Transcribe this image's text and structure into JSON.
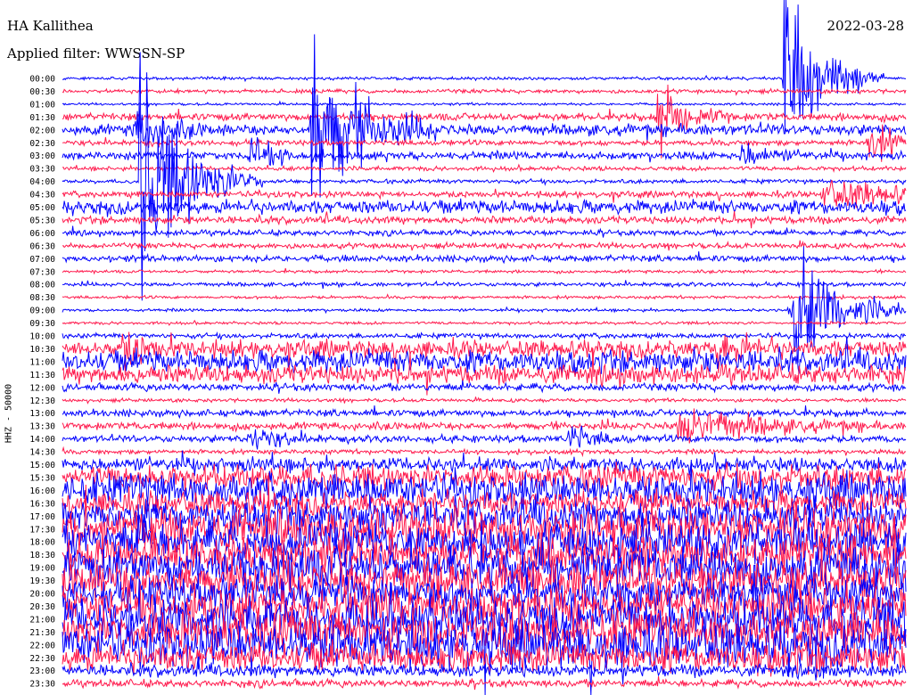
{
  "header": {
    "station": "HA Kallithea",
    "filter_label": "Applied filter:",
    "filter_name": "WWSSN-SP",
    "date": "2022-03-28"
  },
  "colors": {
    "odd": "#0000ff",
    "even": "#ff1a4d",
    "text": "#000000"
  },
  "chart_data": {
    "type": "line",
    "title": "HA Kallithea",
    "ylabel": "HHZ - 50000",
    "xlabel": "",
    "grid": false,
    "series_colors": [
      "#0000ff",
      "#ff1a4d"
    ],
    "row_labels": [
      "00:00",
      "00:30",
      "01:00",
      "01:30",
      "02:00",
      "02:30",
      "03:00",
      "03:30",
      "04:00",
      "04:30",
      "05:00",
      "05:30",
      "06:00",
      "06:30",
      "07:00",
      "07:30",
      "08:00",
      "08:30",
      "09:00",
      "09:30",
      "10:00",
      "10:30",
      "11:00",
      "11:30",
      "12:00",
      "12:30",
      "13:00",
      "13:30",
      "14:00",
      "14:30",
      "15:00",
      "15:30",
      "16:00",
      "16:30",
      "17:00",
      "17:30",
      "18:00",
      "18:30",
      "19:00",
      "19:30",
      "20:00",
      "20:30",
      "21:00",
      "21:30",
      "22:00",
      "22:30",
      "23:00",
      "23:30"
    ],
    "row_noise": [
      1.2,
      1.6,
      1.0,
      3.0,
      4.5,
      2.2,
      3.2,
      1.8,
      1.6,
      2.5,
      5.5,
      3.0,
      2.2,
      2.2,
      2.6,
      1.2,
      1.6,
      1.2,
      1.2,
      1.2,
      2.0,
      7.0,
      9.0,
      7.5,
      3.0,
      1.4,
      2.8,
      3.0,
      2.8,
      1.8,
      6.0,
      10.0,
      14.0,
      10.0,
      13.0,
      16.0,
      16.0,
      15.0,
      17.0,
      16.0,
      14.0,
      16.0,
      18.0,
      17.0,
      18.0,
      12.0,
      5.0,
      3.0
    ],
    "events": [
      {
        "row": 0,
        "x": 0.855,
        "amplitude": 85,
        "duration": 0.04
      },
      {
        "row": 3,
        "x": 0.705,
        "amplitude": 40,
        "duration": 0.03
      },
      {
        "row": 4,
        "x": 0.295,
        "amplitude": 90,
        "duration": 0.05
      },
      {
        "row": 4,
        "x": 0.085,
        "amplitude": 25,
        "duration": 0.03
      },
      {
        "row": 5,
        "x": 0.955,
        "amplitude": 18,
        "duration": 0.05
      },
      {
        "row": 6,
        "x": 0.22,
        "amplitude": 18,
        "duration": 0.03
      },
      {
        "row": 6,
        "x": 0.805,
        "amplitude": 14,
        "duration": 0.03
      },
      {
        "row": 8,
        "x": 0.09,
        "amplitude": 120,
        "duration": 0.05
      },
      {
        "row": 9,
        "x": 0.9,
        "amplitude": 14,
        "duration": 0.12
      },
      {
        "row": 18,
        "x": 0.862,
        "amplitude": 70,
        "duration": 0.05
      },
      {
        "row": 21,
        "x": 0.07,
        "amplitude": 20,
        "duration": 0.02
      },
      {
        "row": 21,
        "x": 0.775,
        "amplitude": 16,
        "duration": 0.03
      },
      {
        "row": 27,
        "x": 0.73,
        "amplitude": 22,
        "duration": 0.08
      },
      {
        "row": 28,
        "x": 0.22,
        "amplitude": 14,
        "duration": 0.03
      },
      {
        "row": 28,
        "x": 0.6,
        "amplitude": 12,
        "duration": 0.03
      }
    ]
  }
}
